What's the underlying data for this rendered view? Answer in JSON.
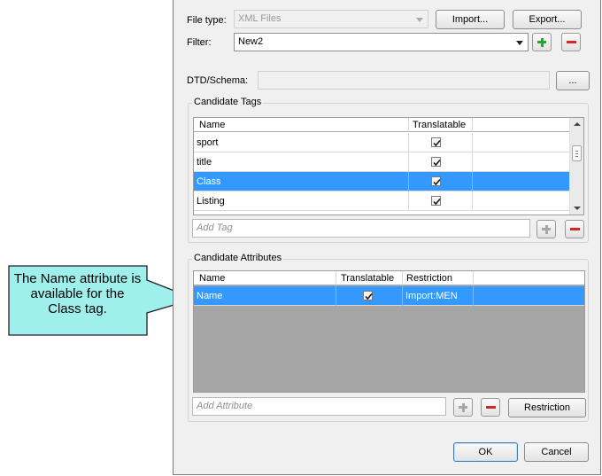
{
  "dialog": {
    "file_type_label": "File type:",
    "file_type_value": "XML Files",
    "import_label": "Import...",
    "export_label": "Export...",
    "filter_label": "Filter:",
    "filter_value": "New2",
    "dtd_label": "DTD/Schema:",
    "dtd_value": "",
    "browse_label": "...",
    "ok_label": "OK",
    "cancel_label": "Cancel"
  },
  "candidate_tags": {
    "title": "Candidate Tags",
    "columns": [
      "Name",
      "Translatable"
    ],
    "rows": [
      {
        "name": "sport",
        "translatable": true,
        "selected": false
      },
      {
        "name": "title",
        "translatable": true,
        "selected": false
      },
      {
        "name": "Class",
        "translatable": true,
        "selected": true
      },
      {
        "name": "Listing",
        "translatable": true,
        "selected": false
      }
    ],
    "add_placeholder": "Add Tag"
  },
  "candidate_attributes": {
    "title": "Candidate Attributes",
    "columns": [
      "Name",
      "Translatable",
      "Restriction"
    ],
    "rows": [
      {
        "name": "Name",
        "translatable": true,
        "restriction": "Import:MEN",
        "selected": true
      }
    ],
    "add_placeholder": "Add Attribute",
    "restriction_label": "Restriction"
  },
  "callout": {
    "text": "The Name attribute is available for the Class tag."
  },
  "colors": {
    "selection": "#3399ff",
    "callout_fill": "#9ff0ec",
    "add_green": "#22a82f",
    "remove_red": "#d0282a"
  }
}
